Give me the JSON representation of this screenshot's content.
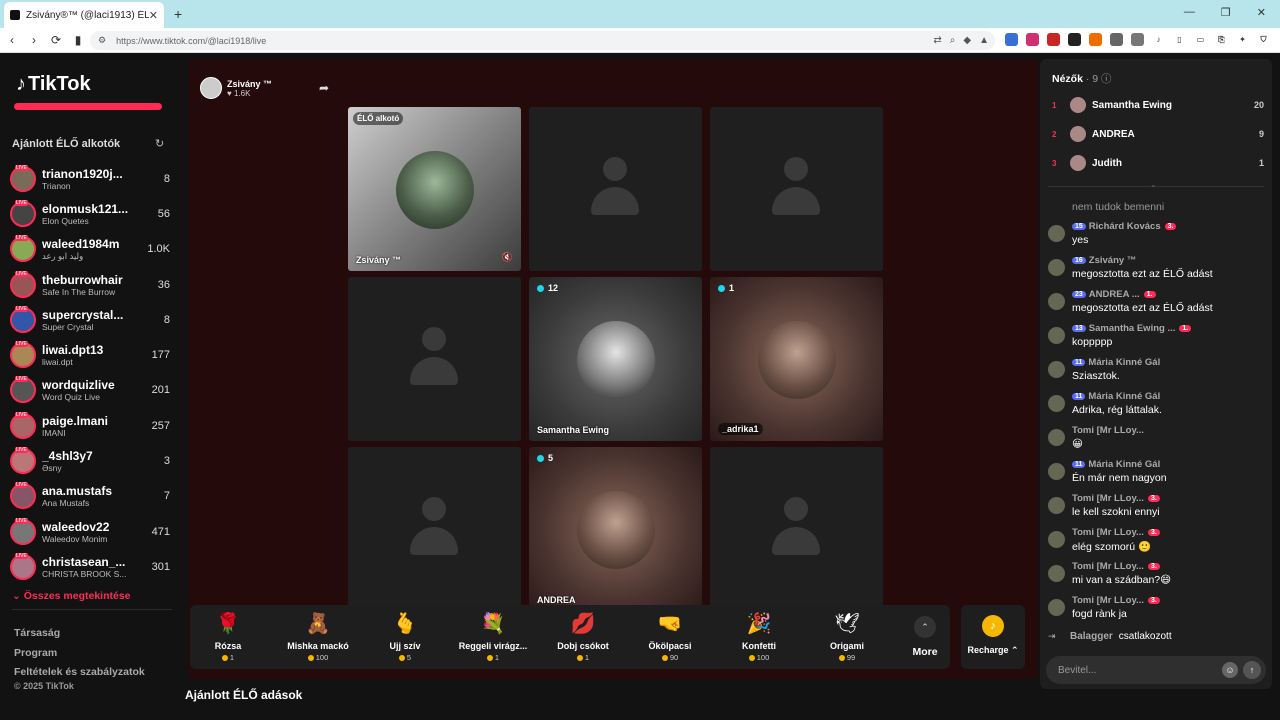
{
  "browser": {
    "tab_title": "Zsivány®™ (@laci1913) ÉLŐ",
    "url": "https://www.tiktok.com/@laci1918/live"
  },
  "sidebar": {
    "logo": "TikTok",
    "section_title": "Ajánlott ÉLŐ alkotók",
    "creators": [
      {
        "name": "trianon1920j...",
        "sub": "Trianon",
        "count": "8"
      },
      {
        "name": "elonmusk121...",
        "sub": "Elon Quetes",
        "count": "56"
      },
      {
        "name": "waleed1984m",
        "sub": "وليد ابو رعد",
        "count": "1.0K"
      },
      {
        "name": "theburrowhair",
        "sub": "Safe In The Burrow",
        "count": "36"
      },
      {
        "name": "supercrystal...",
        "sub": "Super Crystal",
        "count": "8"
      },
      {
        "name": "liwai.dpt13",
        "sub": "liwai.dpt",
        "count": "177"
      },
      {
        "name": "wordquizlive",
        "sub": "Word Quiz Live",
        "count": "201"
      },
      {
        "name": "paige.lmani",
        "sub": "IMANI",
        "count": "257"
      },
      {
        "name": "_4shl3y7",
        "sub": "Əsny",
        "count": "3"
      },
      {
        "name": "ana.mustafs",
        "sub": "Ana Mustafs",
        "count": "7"
      },
      {
        "name": "waleedov22",
        "sub": "Waleedov Monim",
        "count": "471"
      },
      {
        "name": "christasean_...",
        "sub": "CHRISTA BROOK S...",
        "count": "301"
      }
    ],
    "see_all": "Összes megtekintése",
    "footer_links": [
      "Társaság",
      "Program",
      "Feltételek és szabályzatok"
    ],
    "copyright": "© 2025 TikTok"
  },
  "stream": {
    "host_name": "Zsivány ™",
    "host_likes": "♥ 1.6K",
    "host_cell_badge": "ÉLŐ alkotó",
    "host_cell_label": "Zsivány ™",
    "cells": [
      {
        "label": "Samantha Ewing",
        "count": "12"
      },
      {
        "label": "_adrika1",
        "count": "1"
      },
      {
        "label": "ANDREA",
        "count": "5"
      }
    ]
  },
  "gifts": [
    {
      "name": "Rózsa",
      "cost": "1",
      "icon": "🌹"
    },
    {
      "name": "Mishka mackó",
      "cost": "100",
      "icon": "🧸"
    },
    {
      "name": "Ujj szív",
      "cost": "5",
      "icon": "🫰"
    },
    {
      "name": "Reggeli virágz...",
      "cost": "1",
      "icon": "💐"
    },
    {
      "name": "Dobj csókot",
      "cost": "1",
      "icon": "💋"
    },
    {
      "name": "Ökölpacsi",
      "cost": "90",
      "icon": "🤜"
    },
    {
      "name": "Konfetti",
      "cost": "100",
      "icon": "🎉"
    },
    {
      "name": "Origami",
      "cost": "99",
      "icon": "🕊"
    }
  ],
  "more_label": "More",
  "recharge_label": "Recharge",
  "recommended_title": "Ajánlott ÉLŐ adások",
  "viewers": {
    "title": "Nézők",
    "count": "· 9",
    "list": [
      {
        "rank": "1",
        "name": "Samantha Ewing",
        "score": "20"
      },
      {
        "rank": "2",
        "name": "ANDREA",
        "score": "9"
      },
      {
        "rank": "3",
        "name": "Judith",
        "score": "1"
      }
    ]
  },
  "chat": [
    {
      "level": "",
      "name": "",
      "fan": "",
      "text": "nem tudok bemenni"
    },
    {
      "level": "15",
      "name": "Richárd Kovács",
      "fan": "3.",
      "text": "yes"
    },
    {
      "level": "16",
      "name": "Zsivány ™",
      "fan": "",
      "text": "megosztotta ezt az ÉLŐ adást"
    },
    {
      "level": "23",
      "name": "ANDREA ...",
      "fan": "1.",
      "text": "megosztotta ezt az ÉLŐ adást"
    },
    {
      "level": "13",
      "name": "Samantha Ewing ...",
      "fan": "1.",
      "text": "koppppp"
    },
    {
      "level": "11",
      "name": "Mária Kinné Gál",
      "fan": "",
      "text": "Sziasztok."
    },
    {
      "level": "11",
      "name": "Mária Kinné Gál",
      "fan": "",
      "text": "Adrika, rég láttalak."
    },
    {
      "level": "",
      "name": "Tomi [Mr LLoy...",
      "fan": "",
      "text": "😀"
    },
    {
      "level": "11",
      "name": "Mária Kinné Gál",
      "fan": "",
      "text": "Én már nem nagyon"
    },
    {
      "level": "",
      "name": "Tomi [Mr LLoy...",
      "fan": "3.",
      "text": "le kell szokni ennyi"
    },
    {
      "level": "",
      "name": "Tomi [Mr LLoy...",
      "fan": "3.",
      "text": "elég szomorú 🙂"
    },
    {
      "level": "",
      "name": "Tomi [Mr LLoy...",
      "fan": "3.",
      "text": "mi van a szádban?😄"
    },
    {
      "level": "",
      "name": "Tomi [Mr LLoy...",
      "fan": "3.",
      "text": "fogd rànk ja"
    }
  ],
  "joined": {
    "name": "Balagger",
    "text": "csatlakozott"
  },
  "chat_input_placeholder": "Bevitel..."
}
